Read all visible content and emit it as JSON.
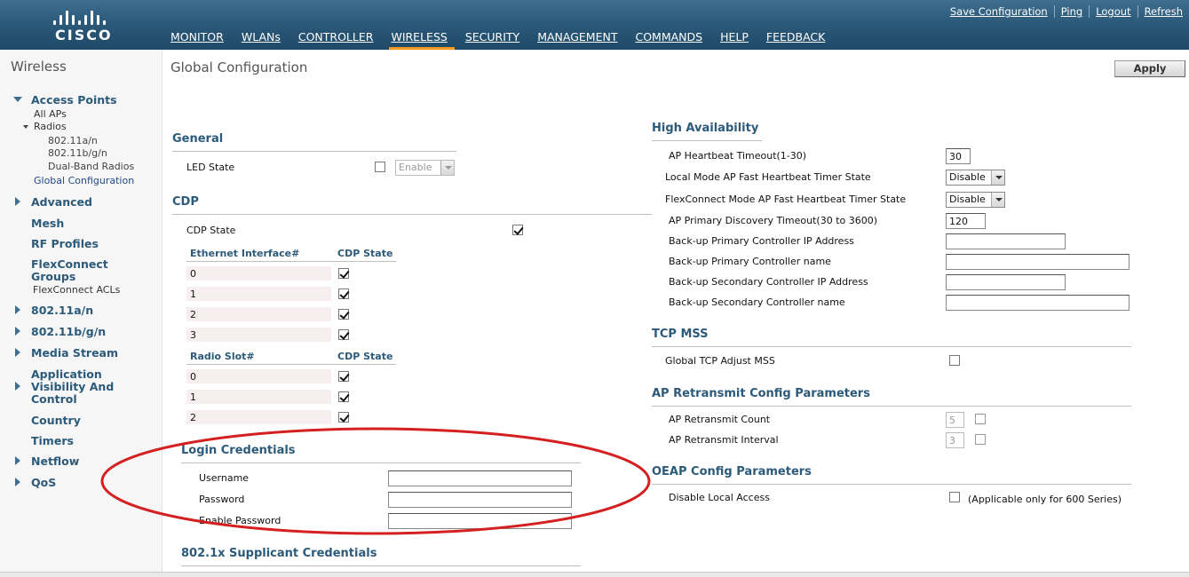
{
  "brand": {
    "logo_text": "CISCO"
  },
  "utility_nav": [
    "Save Configuration",
    "Ping",
    "Logout",
    "Refresh"
  ],
  "top_nav": [
    "MONITOR",
    "WLANs",
    "CONTROLLER",
    "WIRELESS",
    "SECURITY",
    "MANAGEMENT",
    "COMMANDS",
    "HELP",
    "FEEDBACK"
  ],
  "top_nav_active": "WIRELESS",
  "colors": {
    "header": "#2c5a7a",
    "active_tab": "#f39a1e",
    "section_title": "#2c5a7a",
    "annotation": "#d42020"
  },
  "sidebar": {
    "title": "Wireless",
    "access_points": "Access Points",
    "all_aps": "All APs",
    "radios": "Radios",
    "radio_80211an": "802.11a/n",
    "radio_80211bgn": "802.11b/g/n",
    "dual_band": "Dual-Band Radios",
    "global_config": "Global Configuration",
    "advanced": "Advanced",
    "mesh": "Mesh",
    "rf_profiles": "RF Profiles",
    "flexconnect_groups_1": "FlexConnect",
    "flexconnect_groups_2": "Groups",
    "flexconnect_acls": "FlexConnect ACLs",
    "n80211an": "802.11a/n",
    "n80211bgn": "802.11b/g/n",
    "media_stream": "Media Stream",
    "avc_1": "Application",
    "avc_2": "Visibility And",
    "avc_3": "Control",
    "country": "Country",
    "timers": "Timers",
    "netflow": "Netflow",
    "qos": "QoS"
  },
  "page": {
    "title": "Global Configuration",
    "apply": "Apply"
  },
  "general": {
    "title": "General",
    "led_state": "LED State",
    "led_select": "Enable"
  },
  "cdp": {
    "title": "CDP",
    "cdp_state": "CDP State",
    "eth_header": "Ethernet Interface#",
    "state_header": "CDP State",
    "eth_rows": [
      "0",
      "1",
      "2",
      "3"
    ],
    "radio_header": "Radio Slot#",
    "radio_state_header": "CDP State",
    "radio_rows": [
      "0",
      "1",
      "2"
    ]
  },
  "login": {
    "title": "Login Credentials",
    "username": "Username",
    "password": "Password",
    "enable_password": "Enable Password"
  },
  "supplicant": {
    "title": "802.1x Supplicant Credentials"
  },
  "ha": {
    "title": "High Availability",
    "heartbeat": "AP Heartbeat Timeout(1-30)",
    "heartbeat_value": "30",
    "local_fast": "Local Mode AP Fast Heartbeat Timer State",
    "local_fast_value": "Disable",
    "flex_fast": "FlexConnect Mode AP Fast Heartbeat Timer State",
    "flex_fast_value": "Disable",
    "primary_discovery": "AP Primary Discovery Timeout(30 to 3600)",
    "primary_discovery_value": "120",
    "bk_primary_ip": "Back-up Primary Controller IP Address",
    "bk_primary_name": "Back-up Primary Controller name",
    "bk_secondary_ip": "Back-up Secondary Controller IP Address",
    "bk_secondary_name": "Back-up Secondary Controller name"
  },
  "tcp": {
    "title": "TCP MSS",
    "global_adjust": "Global TCP Adjust MSS"
  },
  "retransmit": {
    "title": "AP Retransmit Config Parameters",
    "count": "AP Retransmit Count",
    "count_value": "5",
    "interval": "AP Retransmit Interval",
    "interval_value": "3"
  },
  "oeap": {
    "title": "OEAP Config Parameters",
    "disable_local": "Disable Local Access",
    "note": "(Applicable only for 600 Series)"
  }
}
